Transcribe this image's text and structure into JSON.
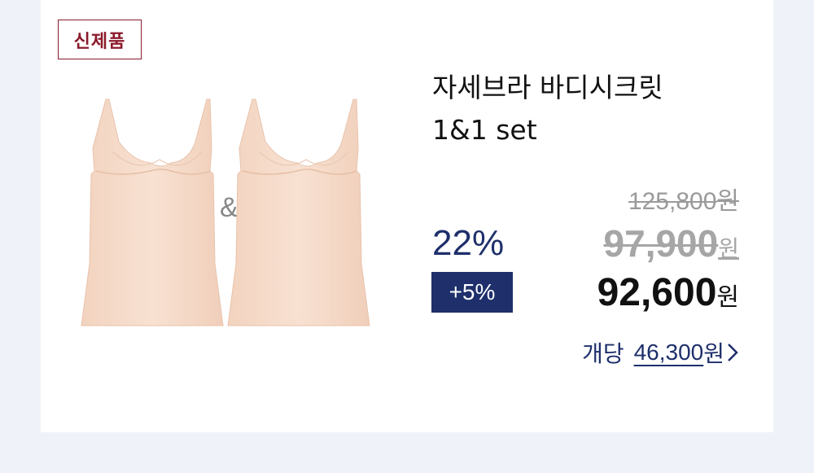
{
  "badge": "신제품",
  "product": {
    "title_line1": "자세브라 바디시크릿",
    "title_line2": "1&1 set",
    "connector": "&"
  },
  "pricing": {
    "original_price": "125,800",
    "original_unit": "원",
    "discount_rate": "22%",
    "discounted_price": "97,900",
    "discounted_unit": "원",
    "extra_discount": "+5%",
    "final_price": "92,600",
    "final_unit": "원",
    "per_unit_label": "개당",
    "per_unit_price": "46,300",
    "per_unit_unit": "원"
  },
  "colors": {
    "accent": "#1e2f6b",
    "badge": "#8b1a2b",
    "product": "#f6dccb",
    "background": "#eff3f9"
  }
}
